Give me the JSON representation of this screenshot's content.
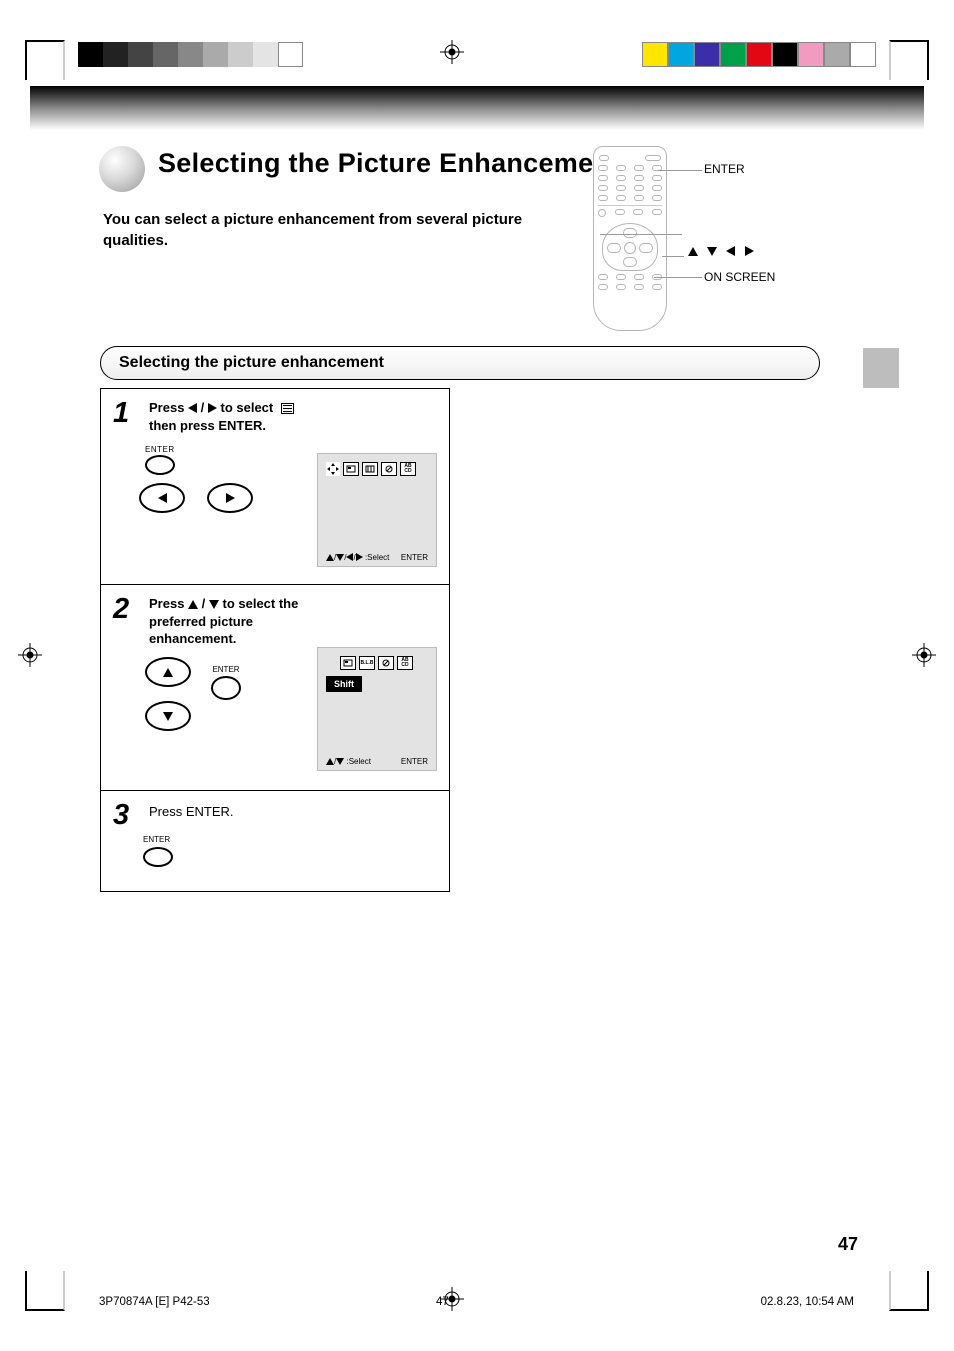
{
  "title": "Selecting the Picture Enhancement",
  "subtitle": "You can select a picture enhancement from several picture qualities.",
  "remote_labels": {
    "enter": "ENTER",
    "arrows": "▲ ▼ ◀ ▶",
    "on_screen": "ON SCREEN"
  },
  "section_heading": "Selecting the picture enhancement",
  "steps": [
    {
      "num": "1",
      "line1_pre": "Press ",
      "line1_post": " to select ",
      "line1_tail": " then press ENTER.",
      "enter_label": "ENTER",
      "panel_foot_select": ":Select",
      "panel_enter": "ENTER"
    },
    {
      "num": "2",
      "line1_pre": "Press ",
      "line1_post": " to select the",
      "line2": "preferred picture",
      "line3": "enhancement.",
      "enter_label": "ENTER",
      "shift_label": "Shift",
      "panel_foot_select": ":Select",
      "panel_enter": "ENTER"
    },
    {
      "num": "3",
      "line1": "Press ENTER.",
      "enter_label": "ENTER"
    }
  ],
  "icon_labels": {
    "shift": "✢",
    "pict": "▦",
    "grid": "▥",
    "slash": "⊘",
    "ab": "AB CD",
    "blb": "B.L.B"
  },
  "page_number": "47",
  "footer_meta": "3P70874A [E]  P42-53",
  "footer_pagespec": "47",
  "footer_time": "02.8.23, 10:54 AM"
}
